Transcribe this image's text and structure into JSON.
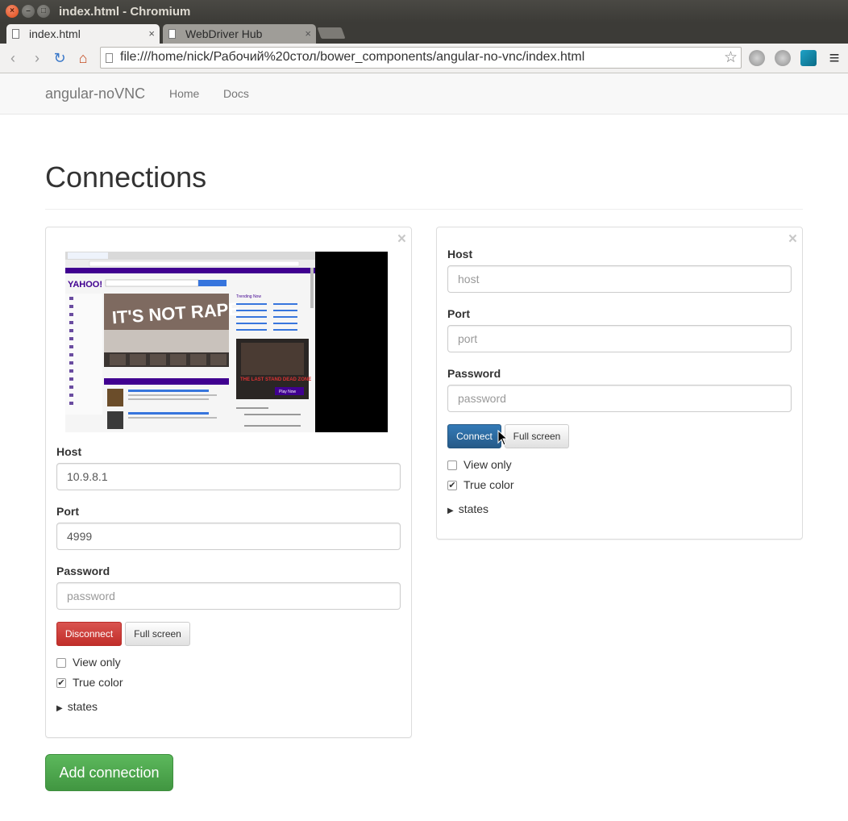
{
  "window": {
    "title": "index.html - Chromium",
    "controls": {
      "close": "×",
      "minimize": "–",
      "maximize": "□"
    }
  },
  "tabs": [
    {
      "label": "index.html",
      "close": "×"
    },
    {
      "label": "WebDriver Hub",
      "close": "×"
    }
  ],
  "toolbar": {
    "url": "file:///home/nick/Рабочий%20стол/bower_components/angular-no-vnc/index.html",
    "back_icon": "‹",
    "forward_icon": "›",
    "reload_icon": "↻",
    "home_icon": "⌂",
    "star_icon": "☆",
    "menu_icon": "≡"
  },
  "navbar": {
    "brand": "angular-noVNC",
    "links": [
      "Home",
      "Docs"
    ]
  },
  "page": {
    "title": "Connections"
  },
  "connections": [
    {
      "close": "×",
      "host_label": "Host",
      "host_value": "10.9.8.1",
      "host_placeholder": "host",
      "port_label": "Port",
      "port_value": "4999",
      "port_placeholder": "port",
      "password_label": "Password",
      "password_value": "",
      "password_placeholder": "password",
      "primary_button": "Disconnect",
      "fullscreen_button": "Full screen",
      "view_only_label": "View only",
      "view_only_checked": false,
      "true_color_label": "True color",
      "true_color_checked": true,
      "states_label": "states",
      "screen": {
        "logo": "YAHOO!",
        "headline": "IT'S NOT RAPE",
        "trending": "Trending Now",
        "ad_text": "THE LAST STAND DEAD ZONE",
        "ad_button": "Play Now"
      }
    },
    {
      "close": "×",
      "host_label": "Host",
      "host_value": "",
      "host_placeholder": "host",
      "port_label": "Port",
      "port_value": "",
      "port_placeholder": "port",
      "password_label": "Password",
      "password_value": "",
      "password_placeholder": "password",
      "primary_button": "Connect",
      "fullscreen_button": "Full screen",
      "view_only_label": "View only",
      "view_only_checked": false,
      "true_color_label": "True color",
      "true_color_checked": true,
      "states_label": "states"
    }
  ],
  "add_button": "Add connection",
  "colors": {
    "danger": "#d9534f",
    "primary": "#337ab7",
    "success": "#5cb85c"
  }
}
